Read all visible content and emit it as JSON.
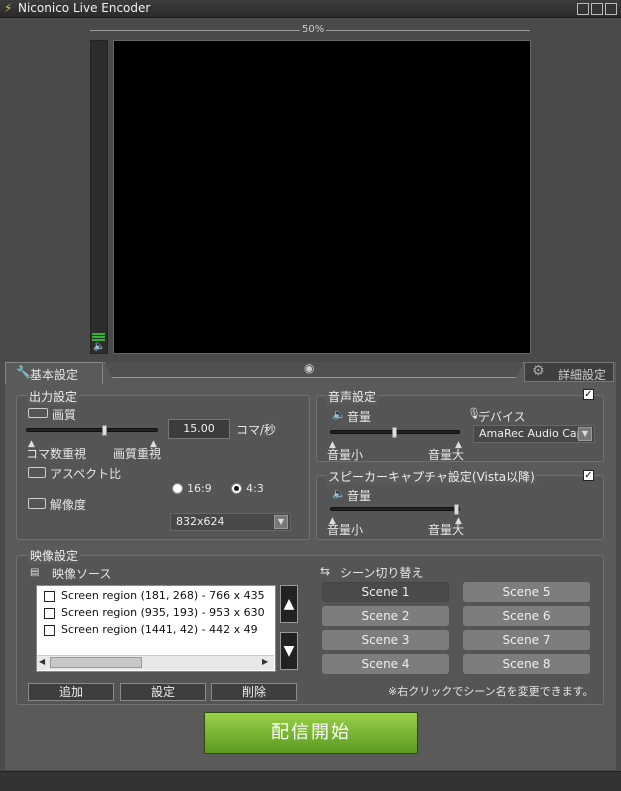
{
  "window": {
    "title": "Niconico Live Encoder"
  },
  "preview": {
    "zoom_label": "50%"
  },
  "tabs": {
    "basic": "基本設定",
    "advanced": "詳細設定"
  },
  "output": {
    "group_label": "出力設定",
    "quality_label": "画質",
    "fps_value": "15.00",
    "fps_unit": "コマ/秒",
    "left_label": "コマ数重視",
    "right_label": "画質重視",
    "slider_value": 0.6,
    "aspect_label": "アスペクト比",
    "aspect_options": [
      "16:9",
      "4:3"
    ],
    "aspect_selected": "4:3",
    "resolution_label": "解像度",
    "resolution_value": "832x624"
  },
  "audio": {
    "group_label": "音声設定",
    "enabled": true,
    "volume_label": "音量",
    "low_label": "音量小",
    "high_label": "音量大",
    "volume_value": 0.5,
    "device_label": "デバイス",
    "device_value": "AmaRec Audio Cap"
  },
  "speaker": {
    "group_label": "スピーカーキャプチャ設定(Vista以降)",
    "enabled": true,
    "volume_label": "音量",
    "low_label": "音量小",
    "high_label": "音量大",
    "volume_value": 1.0
  },
  "video": {
    "group_label": "映像設定",
    "source_label": "映像ソース",
    "sources": [
      {
        "label": "Screen region (181, 268) - 766 x 435",
        "checked": false
      },
      {
        "label": "Screen region (935, 193) - 953 x 630",
        "checked": false
      },
      {
        "label": "Screen region (1441, 42) - 442 x 49",
        "checked": false
      }
    ],
    "add_label": "追加",
    "settings_label": "設定",
    "delete_label": "削除",
    "scene_label": "シーン切り替え",
    "scenes": [
      "Scene 1",
      "Scene 5",
      "Scene 2",
      "Scene 6",
      "Scene 3",
      "Scene 7",
      "Scene 4",
      "Scene 8"
    ],
    "active_scene": "Scene 1",
    "hint": "※右クリックでシーン名を変更できます。"
  },
  "start_button": "配信開始"
}
